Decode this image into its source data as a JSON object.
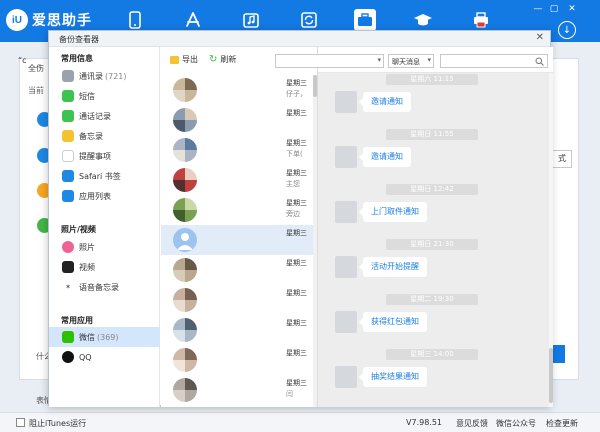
{
  "app": {
    "logo_badge": "iU",
    "logo_text": "爱思助手"
  },
  "nav_icons": [
    "phone-icon",
    "app-store-icon",
    "music-icon",
    "sync-icon",
    "toolbox-icon",
    "graduation-cap-icon",
    "printer-icon"
  ],
  "background": {
    "title_fragment": "全伤",
    "left_fragment_1": "当前",
    "left_fragment_2": "“c",
    "bottom_fragment": "什么",
    "bottom_fragment2": "表情",
    "right_fragment": "式"
  },
  "statusbar": {
    "itunes_label": "阻止iTunes运行",
    "version": "V7.98.51",
    "feedback": "意见反馈",
    "wechat": "微信公众号",
    "update": "检查更新"
  },
  "dialog": {
    "title": "备份查看器",
    "close": "✕",
    "sidebar": {
      "sections": [
        {
          "title": "常用信息",
          "items": [
            {
              "label": "通讯录",
              "count": "(721)",
              "icon": "contacts-icon",
              "color": "#9aa3ad"
            },
            {
              "label": "短信",
              "count": "",
              "icon": "sms-icon",
              "color": "#3dc351"
            },
            {
              "label": "通话记录",
              "count": "",
              "icon": "phone-icon",
              "color": "#3dc351"
            },
            {
              "label": "备忘录",
              "count": "",
              "icon": "notes-icon",
              "color": "#f4c430"
            },
            {
              "label": "提醒事项",
              "count": "",
              "icon": "reminders-icon",
              "color": "#e8e8e8"
            },
            {
              "label": "Safari 书签",
              "count": "",
              "icon": "safari-icon",
              "color": "#1e88e5"
            },
            {
              "label": "应用列表",
              "count": "",
              "icon": "app-store-icon",
              "color": "#1e88e5"
            }
          ]
        },
        {
          "title": "照片/视频",
          "items": [
            {
              "label": "照片",
              "count": "",
              "icon": "photos-icon",
              "color": "#f06292"
            },
            {
              "label": "视频",
              "count": "",
              "icon": "video-icon",
              "color": "#222222"
            },
            {
              "label": "语音备忘录",
              "count": "",
              "icon": "voice-memo-icon",
              "color": "#555555"
            }
          ]
        },
        {
          "title": "常用应用",
          "items": [
            {
              "label": "微信",
              "count": "(369)",
              "icon": "wechat-icon",
              "color": "#2dc100"
            },
            {
              "label": "QQ",
              "count": "",
              "icon": "qq-icon",
              "color": "#111111"
            }
          ]
        }
      ]
    },
    "toolbar": {
      "export_label": "导出",
      "refresh_label": "刷新"
    },
    "filters": {
      "contact_select": "",
      "type_select": "聊天消息",
      "search_placeholder": ""
    },
    "contacts": [
      {
        "day": "星期三",
        "preview": "仔子，",
        "colors": [
          "#c9b79a",
          "#7c6a55",
          "#e0d6c8"
        ]
      },
      {
        "day": "星期三",
        "preview": "",
        "colors": [
          "#8a9cb0",
          "#d8c9b7",
          "#4d5a6a"
        ]
      },
      {
        "day": "星期三",
        "preview": "下单(",
        "colors": [
          "#aab4c4",
          "#5a7aa0",
          "#e6e2da"
        ]
      },
      {
        "day": "星期三",
        "preview": "主您",
        "colors": [
          "#c04040",
          "#e8d0c0",
          "#503030"
        ]
      },
      {
        "day": "星期三",
        "preview": "旁边",
        "colors": [
          "#7aa050",
          "#c8d8a8",
          "#406030"
        ]
      },
      {
        "day": "星期三",
        "preview": "",
        "colors": [
          "#9dc4ef",
          "#ffffff",
          "#9dc4ef"
        ]
      },
      {
        "day": "星期三",
        "preview": "",
        "colors": [
          "#b8a890",
          "#685848",
          "#d8ccb8"
        ]
      },
      {
        "day": "星期三",
        "preview": "",
        "colors": [
          "#c8b0a0",
          "#786050",
          "#e8dcd0"
        ]
      },
      {
        "day": "星期三",
        "preview": "",
        "colors": [
          "#a8b8c8",
          "#506070",
          "#d8e0e8"
        ]
      },
      {
        "day": "星期三",
        "preview": "",
        "colors": [
          "#d0b8a8",
          "#806858",
          "#f0e4dc"
        ]
      },
      {
        "day": "星期三",
        "preview": "闫",
        "colors": [
          "#b0a8a0",
          "#605850",
          "#d8d0c8"
        ]
      },
      {
        "day": "星期三",
        "preview": "",
        "colors": [
          "#a0a8b0",
          "#505860",
          "#c8d0d8"
        ]
      }
    ],
    "messages": [
      {
        "time": "星期六 11:15",
        "text": "邀请通知"
      },
      {
        "time": "星期日 11:55",
        "text": "邀请通知"
      },
      {
        "time": "星期日 12:42",
        "text": "上门取件通知"
      },
      {
        "time": "星期日 21:30",
        "text": "活动开始提醒"
      },
      {
        "time": "星期二 19:30",
        "text": "获得红包通知"
      },
      {
        "time": "星期三 14:00",
        "text": "抽奖结果通知"
      }
    ]
  }
}
